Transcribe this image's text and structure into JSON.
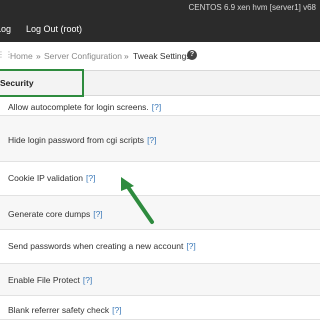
{
  "topbar": {
    "server_info": "CENTOS 6.9 xen hvm [server1]  v68",
    "nav": {
      "log": "Log",
      "logout": "Log Out (root)"
    }
  },
  "breadcrumb": {
    "home": "Home",
    "separator": "»",
    "server_configuration": "Server Configuration",
    "current": "Tweak Settings",
    "help_icon": "?"
  },
  "section": {
    "title": "Security"
  },
  "settings": [
    {
      "label": "Allow autocomplete for login screens.",
      "help": "[?]"
    },
    {
      "label": "Hide login password from cgi scripts",
      "help": "[?]"
    },
    {
      "label": "Cookie IP validation",
      "help": "[?]"
    },
    {
      "label": "Generate core dumps",
      "help": "[?]"
    },
    {
      "label": "Send passwords when creating a new account",
      "help": "[?]"
    },
    {
      "label": "Enable File Protect",
      "help": "[?]"
    },
    {
      "label": "Blank referrer safety check",
      "help": "[?]"
    }
  ],
  "colors": {
    "topbar": "#2b2b2b",
    "link": "#3a78b8",
    "highlight": "#2e8b3e"
  }
}
